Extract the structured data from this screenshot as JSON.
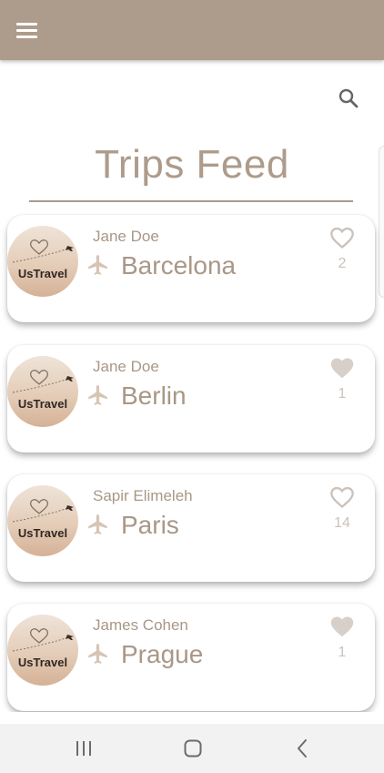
{
  "app_bar": {
    "menu_icon": "hamburger-menu-icon",
    "color": "#ad9b8b"
  },
  "search": {
    "icon": "search-icon"
  },
  "page": {
    "title": "Trips Feed"
  },
  "trips": [
    {
      "author": "Jane Doe",
      "city": "Barcelona",
      "likes": "2",
      "liked": false,
      "logo_text": "UsTravel"
    },
    {
      "author": "Jane Doe",
      "city": "Berlin",
      "likes": "1",
      "liked": true,
      "logo_text": "UsTravel"
    },
    {
      "author": "Sapir Elimeleh",
      "city": "Paris",
      "likes": "14",
      "liked": false,
      "logo_text": "UsTravel"
    },
    {
      "author": "James Cohen",
      "city": "Prague",
      "likes": "1",
      "liked": true,
      "logo_text": "UsTravel"
    }
  ],
  "system_nav": {
    "recents_icon": "recents-icon",
    "home_icon": "home-icon",
    "back_icon": "back-icon"
  },
  "colors": {
    "accent": "#ad9b8b",
    "text": "#a99787",
    "muted": "#cbc2ba"
  }
}
